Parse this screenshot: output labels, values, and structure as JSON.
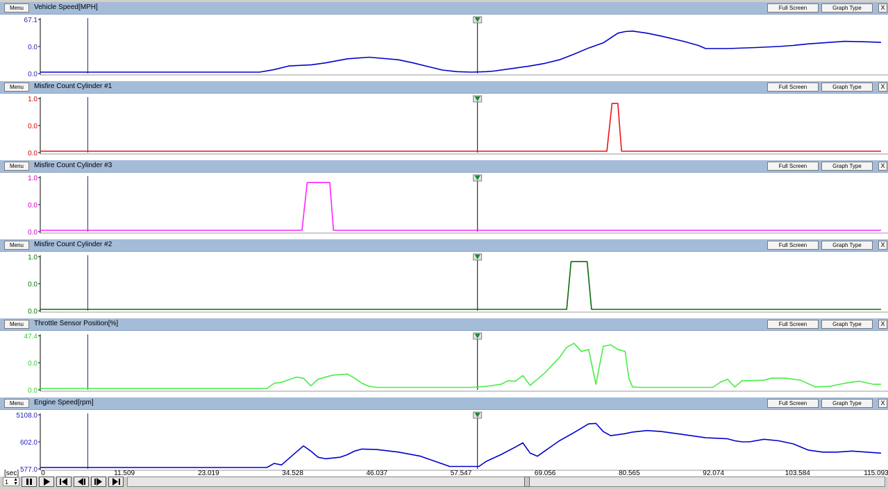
{
  "buttons": {
    "menu": "Menu",
    "full_screen": "Full Screen",
    "graph_type": "Graph Type",
    "close": "X"
  },
  "x_axis": {
    "unit": "[sec]",
    "ticks": [
      "0",
      "11.509",
      "23.019",
      "34.528",
      "46.037",
      "57.547",
      "69.056",
      "80.565",
      "92.074",
      "103.584",
      "115.093"
    ],
    "min": 0,
    "max": 115.093
  },
  "cursors": {
    "left_time": 6.5,
    "right_time": 59.8
  },
  "playback": {
    "speed_value": "1"
  },
  "colors": {
    "header": "#a4bcd8",
    "cursor_marker": "#1a8a3a",
    "axis": "#000000"
  },
  "chart_data": [
    {
      "type": "line",
      "title": "Vehicle Speed[MPH]",
      "yticks": [
        "67.1",
        "0.0",
        "0.0"
      ],
      "tick_color": "#1f1fb8",
      "color": "#0000cc",
      "ylim": [
        0,
        100
      ],
      "series": [
        {
          "x": [
            0,
            30,
            32,
            34,
            37,
            39,
            42,
            45,
            49,
            51,
            53,
            55,
            57,
            59,
            61,
            62,
            64,
            67,
            69,
            71,
            73,
            75,
            77,
            79,
            80,
            81,
            83,
            85,
            88,
            90,
            91,
            94,
            98,
            101,
            103,
            105,
            108,
            110,
            113,
            115
          ],
          "y": [
            0,
            0,
            5,
            12,
            14,
            18,
            26,
            29,
            24,
            18,
            11,
            4,
            1,
            0,
            1,
            2,
            6,
            12,
            17,
            24,
            35,
            47,
            57,
            76,
            79,
            80,
            76,
            70,
            60,
            52,
            46,
            46,
            48,
            50,
            52,
            55,
            58,
            60,
            59,
            58
          ]
        }
      ]
    },
    {
      "type": "line",
      "title": "Misfire Count Cylinder #1",
      "yticks": [
        "1.0",
        "0.0",
        "0.0"
      ],
      "tick_color": "#cc0000",
      "color": "#ee1111",
      "ylim": [
        0,
        1
      ],
      "series": [
        {
          "x": [
            0,
            77.5,
            78.2,
            79,
            79.5,
            115
          ],
          "y": [
            0,
            0,
            0.93,
            0.93,
            0,
            0
          ]
        }
      ]
    },
    {
      "type": "line",
      "title": "Misfire Count Cylinder #3",
      "yticks": [
        "1.0",
        "0.0",
        "0.0"
      ],
      "tick_color": "#cc00cc",
      "color": "#ff22ff",
      "ylim": [
        0,
        1
      ],
      "series": [
        {
          "x": [
            0,
            35.8,
            36.5,
            39.6,
            40.1,
            115
          ],
          "y": [
            0,
            0,
            0.93,
            0.93,
            0,
            0
          ]
        }
      ]
    },
    {
      "type": "line",
      "title": "Misfire Count Cylinder #2",
      "yticks": [
        "1.0",
        "0.0",
        "0.0"
      ],
      "tick_color": "#007700",
      "color": "#0a6a0a",
      "ylim": [
        0,
        1
      ],
      "series": [
        {
          "x": [
            0,
            72.0,
            72.6,
            74.8,
            75.4,
            115
          ],
          "y": [
            0,
            0,
            0.93,
            0.93,
            0,
            0
          ]
        }
      ]
    },
    {
      "type": "line",
      "title": "Throttle Sensor Position[%]",
      "yticks": [
        "47.4",
        "0.0",
        "0.0"
      ],
      "tick_color": "#33cc33",
      "color": "#44ee44",
      "ylim": [
        0,
        100
      ],
      "series": [
        {
          "x": [
            0,
            31,
            32,
            33,
            35,
            36,
            37,
            38,
            40,
            42,
            43,
            44,
            45,
            46,
            49,
            53,
            57,
            59,
            61,
            63,
            64,
            65,
            66,
            67,
            68,
            69,
            70,
            71,
            72,
            73,
            74,
            75,
            76,
            77,
            78,
            79,
            80,
            80.5,
            81,
            82,
            84,
            92,
            93,
            94,
            94.5,
            95,
            96,
            99,
            100,
            102,
            104,
            106,
            108,
            110,
            112,
            114,
            115
          ],
          "y": [
            0,
            0,
            10,
            12,
            22,
            20,
            5,
            18,
            26,
            28,
            20,
            10,
            4,
            2,
            2,
            2,
            2,
            2,
            4,
            8,
            15,
            14,
            25,
            6,
            18,
            30,
            45,
            60,
            80,
            88,
            72,
            76,
            8,
            82,
            85,
            76,
            72,
            20,
            3,
            2,
            2,
            2,
            12,
            18,
            10,
            3,
            15,
            16,
            20,
            20,
            16,
            3,
            4,
            10,
            14,
            8,
            8
          ]
        }
      ]
    },
    {
      "type": "line",
      "title": "Engine Speed[rpm]",
      "yticks": [
        "5108.0",
        "602.0",
        "577.0"
      ],
      "tick_color": "#1f1fb8",
      "color": "#0000cc",
      "ylim": [
        0,
        100
      ],
      "series": [
        {
          "x": [
            0,
            31,
            32,
            33,
            35,
            36,
            37,
            38,
            39,
            41,
            42,
            43,
            44,
            46,
            49,
            52,
            54,
            56,
            59,
            60,
            61,
            63,
            65,
            66,
            67,
            68,
            69,
            70,
            71,
            73,
            75,
            76,
            77,
            78,
            80,
            81,
            83,
            85,
            88,
            91,
            94,
            95,
            96,
            97,
            99,
            101,
            103,
            104,
            105,
            107,
            109,
            111,
            113,
            115
          ],
          "y": [
            0,
            0,
            8,
            5,
            30,
            42,
            32,
            20,
            17,
            20,
            25,
            32,
            36,
            35,
            30,
            22,
            12,
            2,
            2,
            2,
            12,
            25,
            40,
            48,
            28,
            22,
            32,
            42,
            52,
            68,
            85,
            86,
            70,
            62,
            66,
            69,
            72,
            70,
            64,
            58,
            56,
            52,
            50,
            50,
            55,
            52,
            46,
            40,
            34,
            30,
            30,
            32,
            30,
            28
          ]
        }
      ]
    }
  ]
}
